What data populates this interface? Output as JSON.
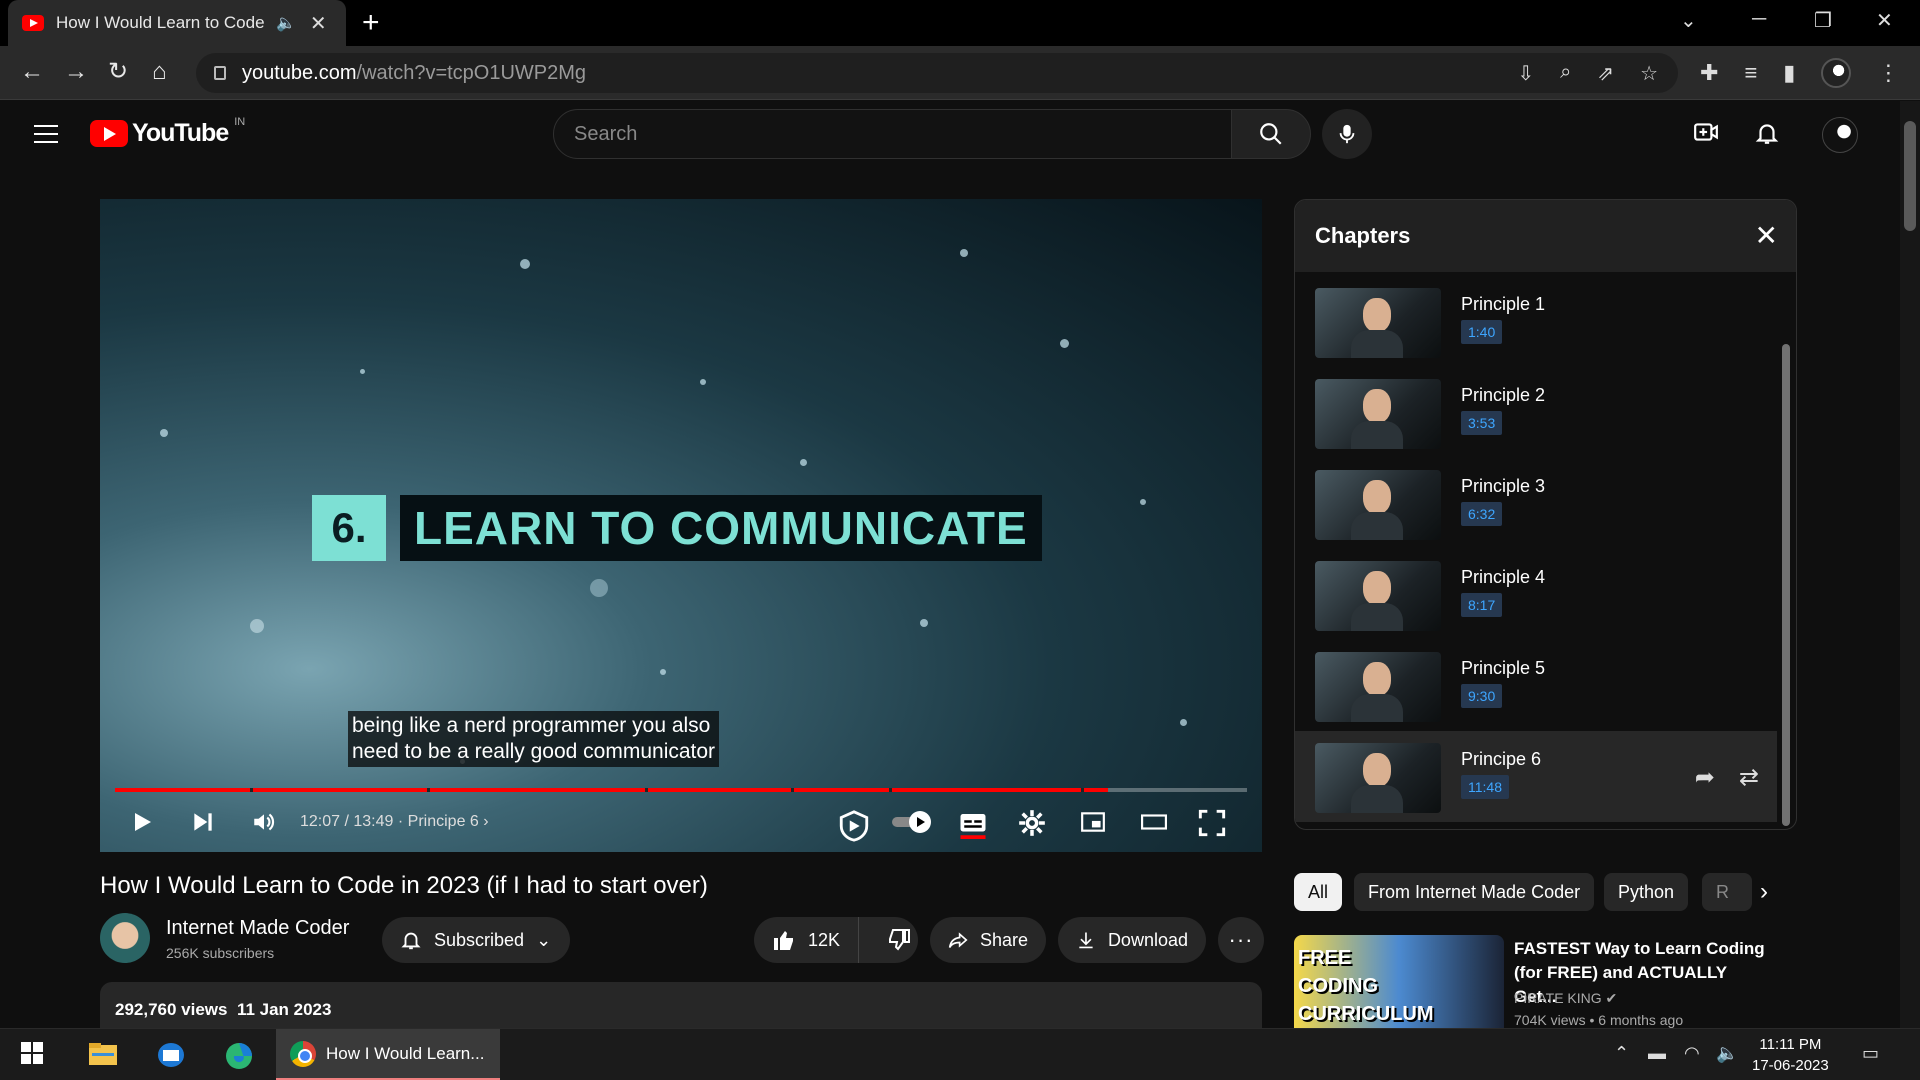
{
  "browser": {
    "tab_title": "How I Would Learn to Code i",
    "url_domain": "youtube.com",
    "url_path": "/watch?v=tcpO1UWP2Mg"
  },
  "header": {
    "logo_text": "YouTube",
    "country_code": "IN",
    "search_placeholder": "Search"
  },
  "player": {
    "overlay_number": "6.",
    "overlay_title": "LEARN TO COMMUNICATE",
    "caption_line1": "being like a nerd programmer you also",
    "caption_line2": "need to be a really good communicator",
    "time": "12:07 / 13:49",
    "chapter_label": "Principe 6",
    "progress_fraction": 0.877
  },
  "video": {
    "title": "How I Would Learn to Code in 2023 (if I had to start over)",
    "channel_name": "Internet Made Coder",
    "subscribers": "256K subscribers",
    "subscribed_label": "Subscribed",
    "likes": "12K",
    "share_label": "Share",
    "download_label": "Download",
    "views": "292,760 views",
    "date": "11 Jan 2023"
  },
  "chapters": {
    "title": "Chapters",
    "items": [
      {
        "name": "Principle 1",
        "time": "1:40"
      },
      {
        "name": "Principle 2",
        "time": "3:53"
      },
      {
        "name": "Principle 3",
        "time": "6:32"
      },
      {
        "name": "Principle 4",
        "time": "8:17"
      },
      {
        "name": "Principle 5",
        "time": "9:30"
      },
      {
        "name": "Principe 6",
        "time": "11:48"
      }
    ]
  },
  "chips": [
    "All",
    "From Internet Made Coder",
    "Python",
    "R"
  ],
  "related": {
    "thumb_line1": "FREE",
    "thumb_line2": "CODING",
    "thumb_line3": "CURRICULUM",
    "title": "FASTEST Way to Learn Coding (for FREE) and ACTUALLY Get...",
    "channel": "PIRATE KING",
    "meta": "704K views • 6 months ago"
  },
  "taskbar": {
    "app_label": "How I Would Learn...",
    "time": "11:11 PM",
    "date": "17-06-2023"
  },
  "colors": {
    "accent_red": "#ff0000",
    "chapter_time_blue": "#3ea6ff",
    "overlay_teal": "#7de0d4"
  }
}
